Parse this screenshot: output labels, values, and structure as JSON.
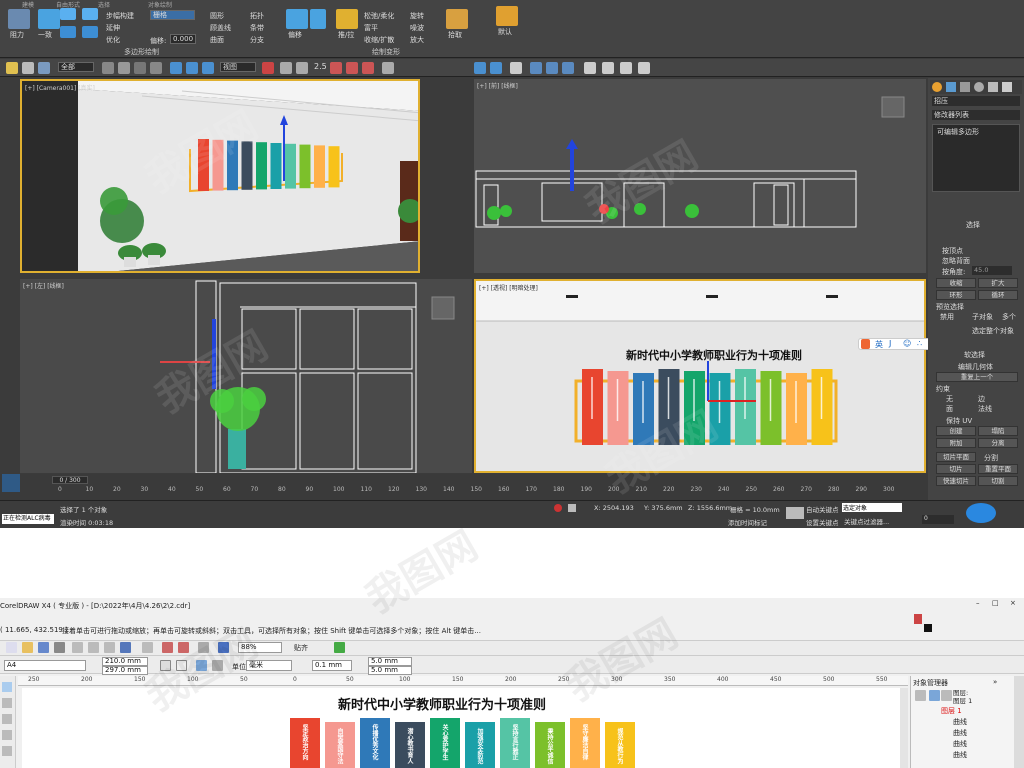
{
  "max": {
    "ribbon": {
      "tabs": [
        "建模",
        "自由形式",
        "选择",
        "对象绘制"
      ],
      "buttons": [
        {
          "name": "icon-1",
          "label": "阻力"
        },
        {
          "name": "icon-2",
          "label": "一致"
        },
        {
          "name": "step-build",
          "label": "步幅构建"
        },
        {
          "name": "extend",
          "label": "延伸"
        },
        {
          "name": "optimize",
          "label": "优化"
        },
        {
          "name": "shape-grid",
          "label": "栅格"
        },
        {
          "name": "offset-label",
          "label": "偏移:"
        },
        {
          "name": "circle",
          "label": "圆形"
        },
        {
          "name": "line-seg",
          "label": "顾盖线"
        },
        {
          "name": "surface",
          "label": "曲面"
        },
        {
          "name": "topo",
          "label": "拓扑"
        },
        {
          "name": "strip",
          "label": "条带"
        },
        {
          "name": "branch",
          "label": "分支"
        },
        {
          "name": "paint-deform",
          "label": "偏移"
        },
        {
          "name": "push-pull",
          "label": "推/拉"
        },
        {
          "name": "smooth-relax",
          "label": "松弛/柔化"
        },
        {
          "name": "rich",
          "label": "富平"
        },
        {
          "name": "shrink-expand",
          "label": "收缩/扩散"
        },
        {
          "name": "spin",
          "label": "旋转"
        },
        {
          "name": "noise",
          "label": "噪波"
        },
        {
          "name": "enlarge",
          "label": "放大"
        },
        {
          "name": "pickup",
          "label": "拾取"
        },
        {
          "name": "default",
          "label": "默认"
        }
      ],
      "offset_value": "0.000",
      "groups": [
        "多边形绘制",
        "绘制变形"
      ],
      "grid_select": "栅格"
    },
    "toolbar": {
      "filter": "全部",
      "view": "视图",
      "snap": "2.5"
    },
    "viewports": [
      {
        "name": "viewport-camera",
        "label": "[+] [Camera001] [真实]"
      },
      {
        "name": "viewport-front",
        "label": "[+] [前] [线框]"
      },
      {
        "name": "viewport-left",
        "label": "[+] [左] [线框]"
      },
      {
        "name": "viewport-perspective",
        "label": "[+] [透视] [明暗处理]"
      }
    ],
    "board_title": "新时代中小学教师职业行为十项准则",
    "board_title_small": "新时代中小学教师职业行为十项准则",
    "ime": [
      "英",
      "J",
      "☺",
      "∴",
      "▤",
      "≡",
      "⚙"
    ],
    "side": {
      "object_name": "招压",
      "modifier_list": "修改器列表",
      "stack_item": "可编辑多边形",
      "section_select": "选择",
      "by_vertex": "按顶点",
      "ignore_back": "忽略背面",
      "by_angle": "按角度:",
      "angle": "45.0",
      "shrink": "收缩",
      "grow": "扩大",
      "ring": "环形",
      "loop": "循环",
      "preview": "预览选择",
      "disable": "禁用",
      "sub_obj": "子对象",
      "multi": "多个",
      "select_all": "选定整个对象",
      "soft_select": "软选择",
      "edit_geo": "编辑几何体",
      "repeat_last": "重复上一个",
      "constraint": "约束",
      "none": "无",
      "edge": "边",
      "face": "面",
      "normal": "法线",
      "keep_uv": "保持 UV",
      "create": "创建",
      "collapse": "塌陷",
      "attach": "附加",
      "detach": "分离",
      "slice_plane": "切片平面",
      "split": "分割",
      "slice": "切片",
      "reset_plane": "重置平面",
      "quick_slice": "快速切片",
      "cut": "切割"
    },
    "timeline": {
      "frame": "0 / 300",
      "ticks": [
        "0",
        "10",
        "20",
        "30",
        "40",
        "50",
        "60",
        "70",
        "80",
        "90",
        "100",
        "110",
        "120",
        "130",
        "140",
        "150",
        "160",
        "170",
        "180",
        "190",
        "200",
        "210",
        "220",
        "230",
        "240",
        "250",
        "260",
        "270",
        "280",
        "290",
        "300"
      ]
    },
    "status": {
      "selected": "选择了 1 个对象",
      "working": "正在检测ALC病毒",
      "render_time": "渲染时间 0:03:18",
      "x": "X: 2504.193",
      "y": "Y: 375.6mm",
      "z": "Z: 1556.6mm",
      "grid": "栅格 = 10.0mm",
      "add_tag": "添加时间标记",
      "auto_key": "自动关键点",
      "set_key": "设置关键点",
      "selected_obj": "选定对象",
      "key_filter": "关键点过滤器...",
      "frame_field": "0"
    }
  },
  "corel": {
    "title": "CorelDRAW X4 ( 专业版 ) - [D:\\2022年\\4月\\4.26\\2\\2.cdr]",
    "coords": "( 11.665, 432.519 )",
    "hint": "接着单击可进行拖动或缩放；再单击可旋转或斜斜；双击工具，可选择所有对象；按住 Shift 键单击可选择多个对象；按住 Alt 键单击...",
    "page_size": "A4",
    "width": "210.0 mm",
    "height": "297.0 mm",
    "zoom": "88%",
    "snap": "贴齐",
    "unit_label": "单位:",
    "unit": "毫米",
    "nudge": "0.1 mm",
    "dup_x": "5.0 mm",
    "dup_y": "5.0 mm",
    "ruler": [
      "250",
      "200",
      "150",
      "100",
      "50",
      "0",
      "50",
      "100",
      "150",
      "200",
      "250",
      "300",
      "350",
      "400",
      "450",
      "500",
      "550"
    ],
    "doc_title": "新时代中小学教师职业行为十项准则",
    "panel_title": "对象管理器",
    "panel_items": [
      {
        "name": "page-1",
        "label": "图层:"
      },
      {
        "name": "page-2",
        "label": "图层 1"
      },
      {
        "name": "layer-1",
        "label": "图层 1"
      },
      {
        "name": "curve-1",
        "label": "曲线"
      },
      {
        "name": "curve-2",
        "label": "曲线"
      },
      {
        "name": "curve-3",
        "label": "曲线"
      },
      {
        "name": "curve-4",
        "label": "曲线"
      }
    ],
    "banners": [
      {
        "color": "#e8452f",
        "text": "坚定政治方向"
      },
      {
        "color": "#f59890",
        "text": "自觉爱国守法"
      },
      {
        "color": "#2f79b8",
        "text": "传播优秀文化"
      },
      {
        "color": "#3b4c5e",
        "text": "潜心教书育人"
      },
      {
        "color": "#14a56b",
        "text": "关心爱护学生"
      },
      {
        "color": "#1aa0a8",
        "text": "加强安全防范"
      },
      {
        "color": "#55c4a5",
        "text": "坚持言行雅正"
      },
      {
        "color": "#7cc02b",
        "text": "秉持公平诚信"
      },
      {
        "color": "#ffb14a",
        "text": "坚守廉洁自律"
      },
      {
        "color": "#f7c21a",
        "text": "规范从教行为"
      }
    ]
  },
  "watermark": "我图网"
}
